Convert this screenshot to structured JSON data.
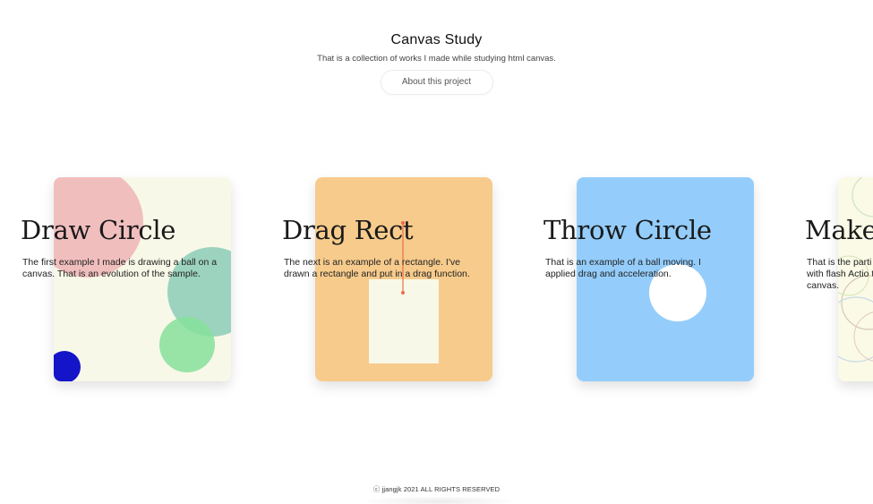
{
  "header": {
    "title": "Canvas Study",
    "subtitle": "That is a collection of works I made while studying html canvas.",
    "about_button": "About this project"
  },
  "cards": [
    {
      "title": "Draw Circle",
      "description": "The first example I made is drawing a ball on a canvas. That is an evolution of the sample.",
      "background": "#f8f8e8"
    },
    {
      "title": "Drag Rect",
      "description": "The next is an example of a rectangle. I've drawn a rectangle and put in a drag function.",
      "background": "#f7cb8c"
    },
    {
      "title": "Throw Circle",
      "description": "That is an example of a ball moving. I applied drag and acceleration.",
      "background": "#94cdfb"
    },
    {
      "title": "Make",
      "description": "That is the parti with flash Actio to canvas.",
      "background": "#fafae6"
    }
  ],
  "footer": {
    "copyright": "ⓒ jjangjk 2021 ALL RIGHTS RESERVED"
  },
  "colors": {
    "pink_circle": "#f0b4b6",
    "teal_circle": "#84c9b4",
    "green_circle": "#86e19a",
    "blue_circle": "#1414c8",
    "drag_line": "#ef6b4a"
  }
}
